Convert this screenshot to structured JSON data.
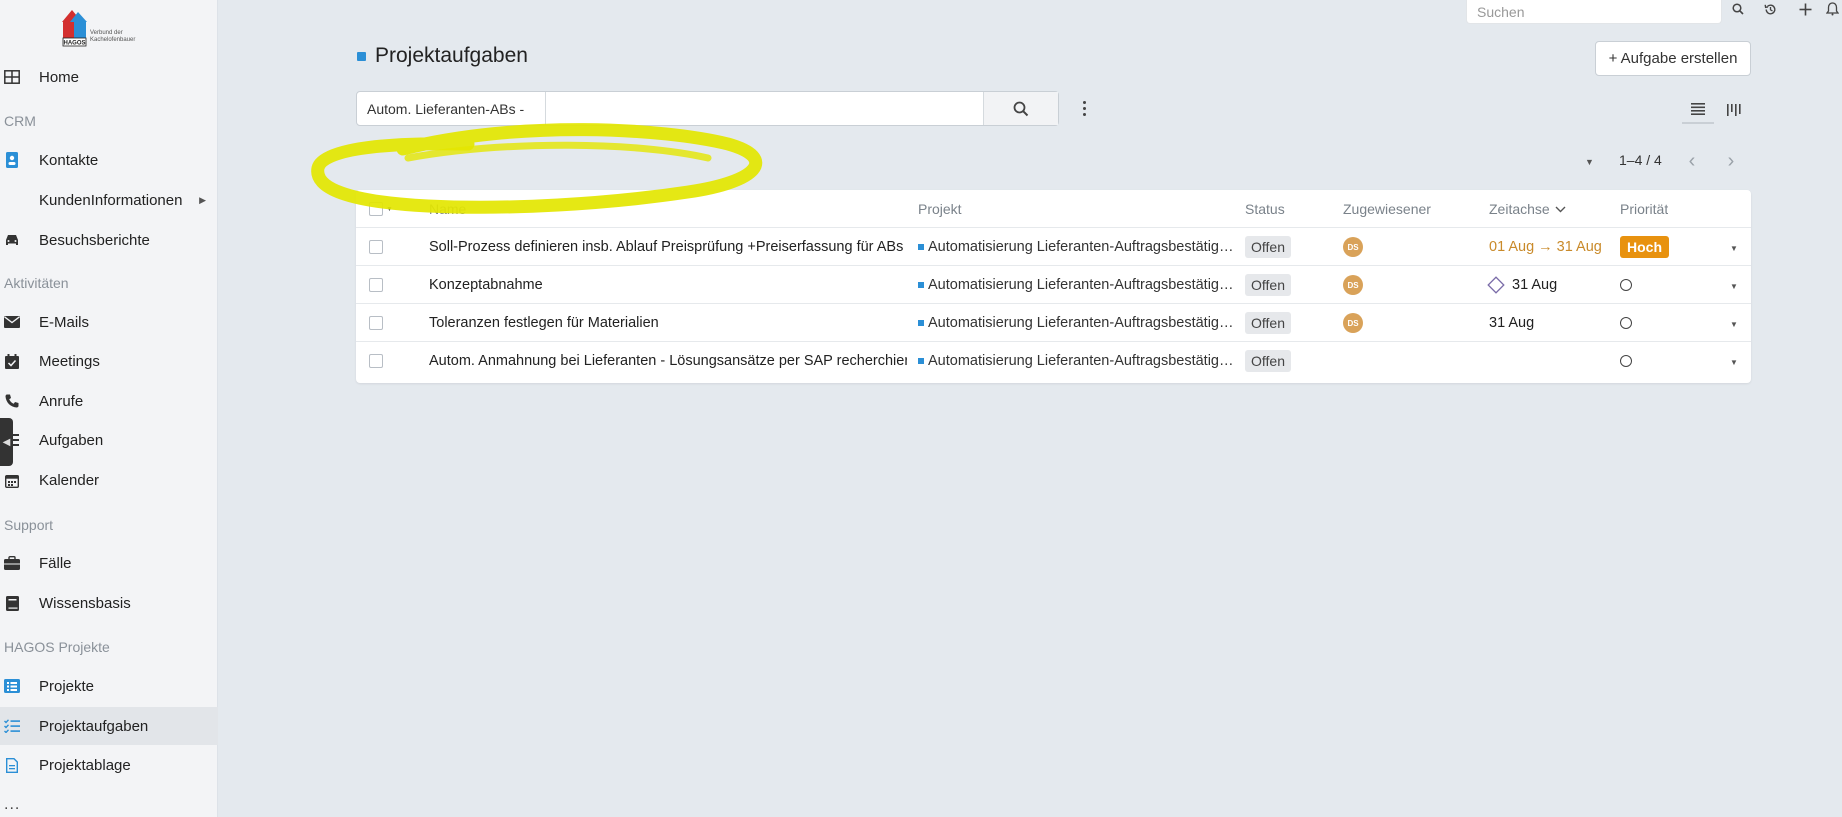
{
  "sidebar": {
    "logo": {
      "brand": "HAGOS",
      "tagline": "Verbund der Kachelofenbauer"
    },
    "items": [
      {
        "label": "Home",
        "icon": "grid-icon"
      },
      {
        "section": "CRM"
      },
      {
        "label": "Kontakte",
        "icon": "contact-card-icon"
      },
      {
        "label": "KundenInformationen",
        "icon": "",
        "submenu": true
      },
      {
        "label": "Besuchsberichte",
        "icon": "car-icon"
      },
      {
        "section": "Aktivitäten"
      },
      {
        "label": "E-Mails",
        "icon": "envelope-icon"
      },
      {
        "label": "Meetings",
        "icon": "calendar-check-icon"
      },
      {
        "label": "Anrufe",
        "icon": "phone-icon"
      },
      {
        "label": "Aufgaben",
        "icon": "list-icon"
      },
      {
        "label": "Kalender",
        "icon": "calendar-icon"
      },
      {
        "section": "Support"
      },
      {
        "label": "Fälle",
        "icon": "briefcase-icon"
      },
      {
        "label": "Wissensbasis",
        "icon": "book-icon"
      },
      {
        "section": "HAGOS Projekte"
      },
      {
        "label": "Projekte",
        "icon": "list-box-icon"
      },
      {
        "label": "Projektaufgaben",
        "icon": "checklist-icon",
        "active": true
      },
      {
        "label": "Projektablage",
        "icon": "document-icon"
      }
    ],
    "more": "..."
  },
  "topbar": {
    "search_placeholder": "Suchen",
    "icons": [
      "search-icon",
      "history-icon",
      "plus-icon",
      "bell-icon"
    ]
  },
  "page": {
    "title": "Projektaufgaben",
    "create_button": "+ Aufgabe erstellen",
    "accent": "#2b8fd6"
  },
  "filter": {
    "selected": "Autom. Lieferanten-ABs -",
    "text_value": ""
  },
  "pagination": {
    "range": "1–4 / 4"
  },
  "table": {
    "columns": [
      "Name",
      "Projekt",
      "Status",
      "Zugewiesener",
      "Zeitachse",
      "Priorität"
    ],
    "rows": [
      {
        "name": "Soll-Prozess definieren insb. Ablauf Preisprüfung +Preiserfassung für ABs in SAP",
        "project": "Automatisierung Lieferanten-Auftragsbestätigungen",
        "status": "Offen",
        "assignee": "DS",
        "timeline_start": "01 Aug",
        "timeline_end": "31 Aug",
        "priority": "Hoch"
      },
      {
        "name": "Konzeptabnahme",
        "project": "Automatisierung Lieferanten-Auftragsbestätigungen",
        "status": "Offen",
        "assignee": "DS",
        "milestone": true,
        "timeline_end": "31 Aug",
        "priority": ""
      },
      {
        "name": "Toleranzen festlegen für Materialien",
        "project": "Automatisierung Lieferanten-Auftragsbestätigungen",
        "status": "Offen",
        "assignee": "DS",
        "timeline_end": "31 Aug",
        "priority": ""
      },
      {
        "name": "Autom. Anmahnung bei Lieferanten - Lösungsansätze per SAP recherchieren",
        "project": "Automatisierung Lieferanten-Auftragsbestätigungen",
        "status": "Offen",
        "assignee": "",
        "timeline_end": "",
        "priority": ""
      }
    ]
  },
  "colors": {
    "highlight": "#e3e600",
    "priority_high": "#e8920f",
    "timeline_overdue": "#c98a2a",
    "avatar": "#d9a259"
  }
}
